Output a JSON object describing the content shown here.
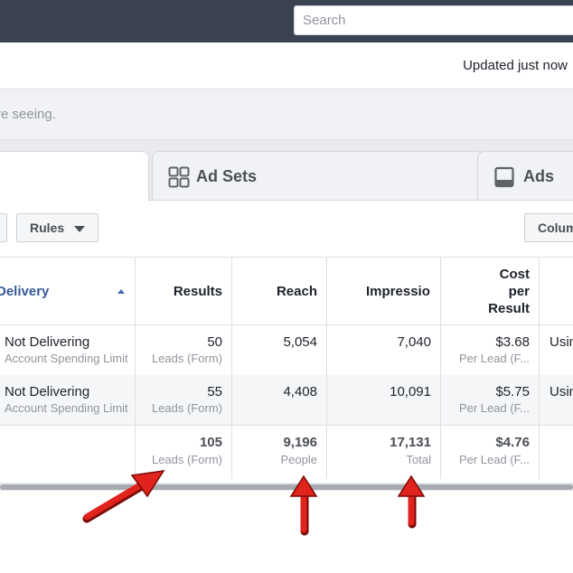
{
  "search": {
    "placeholder": "Search"
  },
  "status": {
    "updated": "Updated just now"
  },
  "notice": {
    "text": "re seeing."
  },
  "tabs": [
    {
      "label": "Ad Sets",
      "icon": "ad-sets-grid-icon"
    },
    {
      "label": "Ads",
      "icon": "ads-monitor-icon"
    }
  ],
  "toolbar": {
    "rules_label": "Rules",
    "columns_label": "Colum"
  },
  "table": {
    "headers": {
      "delivery": "Delivery",
      "results": "Results",
      "reach": "Reach",
      "impressions": "Impressio",
      "cost_line1": "Cost",
      "cost_line2": "per",
      "cost_line3": "Result"
    },
    "rows": [
      {
        "delivery": "Not Delivering",
        "delivery_sub": "Account Spending Limit",
        "results": "50",
        "results_sub": "Leads (Form)",
        "reach": "5,054",
        "impressions": "7,040",
        "cost": "$3.68",
        "cost_sub": "Per Lead (F...",
        "extra": "Usin"
      },
      {
        "delivery": "Not Delivering",
        "delivery_sub": "Account Spending Limit",
        "results": "55",
        "results_sub": "Leads (Form)",
        "reach": "4,408",
        "impressions": "10,091",
        "cost": "$5.75",
        "cost_sub": "Per Lead (F...",
        "extra": "Usin"
      }
    ],
    "totals": {
      "results": "105",
      "results_sub": "Leads (Form)",
      "reach": "9,196",
      "reach_sub": "People",
      "impressions": "17,131",
      "impressions_sub": "Total",
      "cost": "$4.76",
      "cost_sub": "Per Lead (F..."
    }
  },
  "colors": {
    "topbar": "#3b4352",
    "link": "#365899",
    "annotation_arrow": "#e0231c"
  }
}
